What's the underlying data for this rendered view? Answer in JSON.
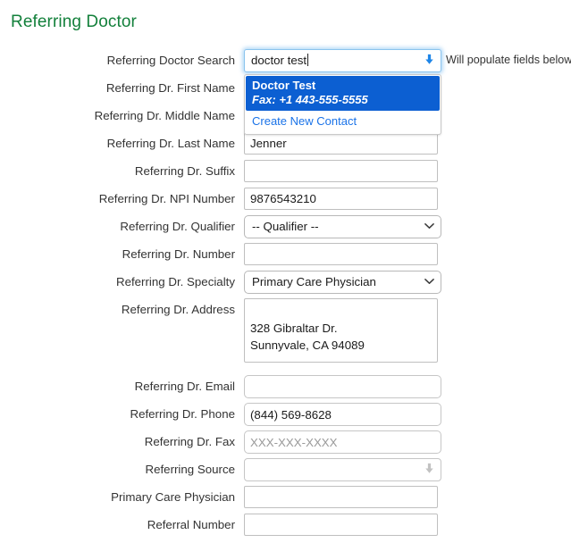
{
  "page": {
    "title": "Referring Doctor",
    "title_color": "#13803b"
  },
  "search": {
    "label": "Referring Doctor Search",
    "value": "doctor test",
    "hint": "Will populate fields below",
    "arrow_icon": "arrow-down-icon",
    "suggestions": [
      {
        "name": "Doctor Test",
        "detail": "Fax: +1 443-555-5555",
        "selected": true,
        "highlight_color": "#0c5fd2"
      }
    ],
    "create_link": "Create New Contact",
    "link_color": "#1a73e8"
  },
  "fields": {
    "first_name": {
      "label": "Referring Dr. First Name",
      "value": "",
      "placeholder": ""
    },
    "middle_name": {
      "label": "Referring Dr. Middle Name",
      "value": "",
      "placeholder": ""
    },
    "last_name": {
      "label": "Referring Dr. Last Name",
      "value": "Jenner",
      "placeholder": ""
    },
    "suffix": {
      "label": "Referring Dr. Suffix",
      "value": "",
      "placeholder": ""
    },
    "npi_number": {
      "label": "Referring Dr. NPI Number",
      "value": "9876543210",
      "placeholder": ""
    },
    "qualifier": {
      "label": "Referring Dr. Qualifier",
      "value": "-- Qualifier --"
    },
    "number": {
      "label": "Referring Dr. Number",
      "value": "",
      "placeholder": ""
    },
    "specialty": {
      "label": "Referring Dr. Specialty",
      "value": "Primary Care Physician"
    },
    "address": {
      "label": "Referring Dr. Address",
      "value": "328 Gibraltar Dr.\nSunnyvale, CA 94089"
    },
    "email": {
      "label": "Referring Dr. Email",
      "value": "",
      "placeholder": ""
    },
    "phone": {
      "label": "Referring Dr. Phone",
      "value": "(844) 569-8628",
      "placeholder": ""
    },
    "fax": {
      "label": "Referring Dr. Fax",
      "value": "",
      "placeholder": "XXX-XXX-XXXX"
    },
    "referring_source": {
      "label": "Referring Source",
      "value": "",
      "arrow_icon": "arrow-down-icon"
    },
    "primary_care_physician": {
      "label": "Primary Care Physician",
      "value": "",
      "placeholder": ""
    },
    "referral_number": {
      "label": "Referral Number",
      "value": "",
      "placeholder": ""
    }
  },
  "icons": {
    "arrow_down": "⬇",
    "chevron_down": "∨"
  }
}
